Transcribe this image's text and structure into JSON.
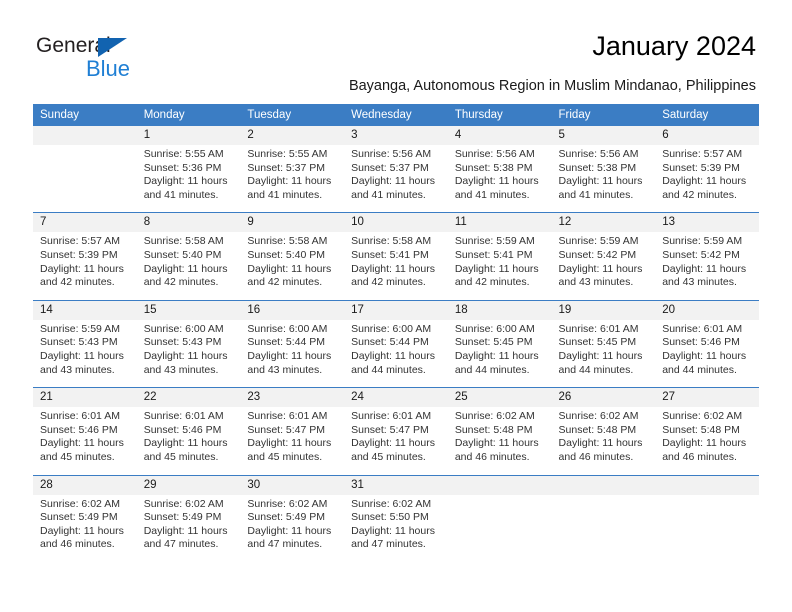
{
  "brand": {
    "name_part1": "General",
    "name_part2": "Blue",
    "triangle_color": "#1263b0",
    "blue_color": "#1f7fd4"
  },
  "header": {
    "title": "January 2024",
    "subtitle": "Bayanga, Autonomous Region in Muslim Mindanao, Philippines"
  },
  "theme": {
    "header_bg": "#3b7dc4",
    "daynum_bg": "#f2f2f2",
    "separator": "#3b7dc4"
  },
  "calendar": {
    "weekday_headers": [
      "Sunday",
      "Monday",
      "Tuesday",
      "Wednesday",
      "Thursday",
      "Friday",
      "Saturday"
    ],
    "weeks": [
      [
        {
          "day": "",
          "sunrise": "",
          "sunset": "",
          "daylight_line1": "",
          "daylight_line2": "",
          "empty": true
        },
        {
          "day": "1",
          "sunrise": "Sunrise: 5:55 AM",
          "sunset": "Sunset: 5:36 PM",
          "daylight_line1": "Daylight: 11 hours",
          "daylight_line2": "and 41 minutes."
        },
        {
          "day": "2",
          "sunrise": "Sunrise: 5:55 AM",
          "sunset": "Sunset: 5:37 PM",
          "daylight_line1": "Daylight: 11 hours",
          "daylight_line2": "and 41 minutes."
        },
        {
          "day": "3",
          "sunrise": "Sunrise: 5:56 AM",
          "sunset": "Sunset: 5:37 PM",
          "daylight_line1": "Daylight: 11 hours",
          "daylight_line2": "and 41 minutes."
        },
        {
          "day": "4",
          "sunrise": "Sunrise: 5:56 AM",
          "sunset": "Sunset: 5:38 PM",
          "daylight_line1": "Daylight: 11 hours",
          "daylight_line2": "and 41 minutes."
        },
        {
          "day": "5",
          "sunrise": "Sunrise: 5:56 AM",
          "sunset": "Sunset: 5:38 PM",
          "daylight_line1": "Daylight: 11 hours",
          "daylight_line2": "and 41 minutes."
        },
        {
          "day": "6",
          "sunrise": "Sunrise: 5:57 AM",
          "sunset": "Sunset: 5:39 PM",
          "daylight_line1": "Daylight: 11 hours",
          "daylight_line2": "and 42 minutes."
        }
      ],
      [
        {
          "day": "7",
          "sunrise": "Sunrise: 5:57 AM",
          "sunset": "Sunset: 5:39 PM",
          "daylight_line1": "Daylight: 11 hours",
          "daylight_line2": "and 42 minutes."
        },
        {
          "day": "8",
          "sunrise": "Sunrise: 5:58 AM",
          "sunset": "Sunset: 5:40 PM",
          "daylight_line1": "Daylight: 11 hours",
          "daylight_line2": "and 42 minutes."
        },
        {
          "day": "9",
          "sunrise": "Sunrise: 5:58 AM",
          "sunset": "Sunset: 5:40 PM",
          "daylight_line1": "Daylight: 11 hours",
          "daylight_line2": "and 42 minutes."
        },
        {
          "day": "10",
          "sunrise": "Sunrise: 5:58 AM",
          "sunset": "Sunset: 5:41 PM",
          "daylight_line1": "Daylight: 11 hours",
          "daylight_line2": "and 42 minutes."
        },
        {
          "day": "11",
          "sunrise": "Sunrise: 5:59 AM",
          "sunset": "Sunset: 5:41 PM",
          "daylight_line1": "Daylight: 11 hours",
          "daylight_line2": "and 42 minutes."
        },
        {
          "day": "12",
          "sunrise": "Sunrise: 5:59 AM",
          "sunset": "Sunset: 5:42 PM",
          "daylight_line1": "Daylight: 11 hours",
          "daylight_line2": "and 43 minutes."
        },
        {
          "day": "13",
          "sunrise": "Sunrise: 5:59 AM",
          "sunset": "Sunset: 5:42 PM",
          "daylight_line1": "Daylight: 11 hours",
          "daylight_line2": "and 43 minutes."
        }
      ],
      [
        {
          "day": "14",
          "sunrise": "Sunrise: 5:59 AM",
          "sunset": "Sunset: 5:43 PM",
          "daylight_line1": "Daylight: 11 hours",
          "daylight_line2": "and 43 minutes."
        },
        {
          "day": "15",
          "sunrise": "Sunrise: 6:00 AM",
          "sunset": "Sunset: 5:43 PM",
          "daylight_line1": "Daylight: 11 hours",
          "daylight_line2": "and 43 minutes."
        },
        {
          "day": "16",
          "sunrise": "Sunrise: 6:00 AM",
          "sunset": "Sunset: 5:44 PM",
          "daylight_line1": "Daylight: 11 hours",
          "daylight_line2": "and 43 minutes."
        },
        {
          "day": "17",
          "sunrise": "Sunrise: 6:00 AM",
          "sunset": "Sunset: 5:44 PM",
          "daylight_line1": "Daylight: 11 hours",
          "daylight_line2": "and 44 minutes."
        },
        {
          "day": "18",
          "sunrise": "Sunrise: 6:00 AM",
          "sunset": "Sunset: 5:45 PM",
          "daylight_line1": "Daylight: 11 hours",
          "daylight_line2": "and 44 minutes."
        },
        {
          "day": "19",
          "sunrise": "Sunrise: 6:01 AM",
          "sunset": "Sunset: 5:45 PM",
          "daylight_line1": "Daylight: 11 hours",
          "daylight_line2": "and 44 minutes."
        },
        {
          "day": "20",
          "sunrise": "Sunrise: 6:01 AM",
          "sunset": "Sunset: 5:46 PM",
          "daylight_line1": "Daylight: 11 hours",
          "daylight_line2": "and 44 minutes."
        }
      ],
      [
        {
          "day": "21",
          "sunrise": "Sunrise: 6:01 AM",
          "sunset": "Sunset: 5:46 PM",
          "daylight_line1": "Daylight: 11 hours",
          "daylight_line2": "and 45 minutes."
        },
        {
          "day": "22",
          "sunrise": "Sunrise: 6:01 AM",
          "sunset": "Sunset: 5:46 PM",
          "daylight_line1": "Daylight: 11 hours",
          "daylight_line2": "and 45 minutes."
        },
        {
          "day": "23",
          "sunrise": "Sunrise: 6:01 AM",
          "sunset": "Sunset: 5:47 PM",
          "daylight_line1": "Daylight: 11 hours",
          "daylight_line2": "and 45 minutes."
        },
        {
          "day": "24",
          "sunrise": "Sunrise: 6:01 AM",
          "sunset": "Sunset: 5:47 PM",
          "daylight_line1": "Daylight: 11 hours",
          "daylight_line2": "and 45 minutes."
        },
        {
          "day": "25",
          "sunrise": "Sunrise: 6:02 AM",
          "sunset": "Sunset: 5:48 PM",
          "daylight_line1": "Daylight: 11 hours",
          "daylight_line2": "and 46 minutes."
        },
        {
          "day": "26",
          "sunrise": "Sunrise: 6:02 AM",
          "sunset": "Sunset: 5:48 PM",
          "daylight_line1": "Daylight: 11 hours",
          "daylight_line2": "and 46 minutes."
        },
        {
          "day": "27",
          "sunrise": "Sunrise: 6:02 AM",
          "sunset": "Sunset: 5:48 PM",
          "daylight_line1": "Daylight: 11 hours",
          "daylight_line2": "and 46 minutes."
        }
      ],
      [
        {
          "day": "28",
          "sunrise": "Sunrise: 6:02 AM",
          "sunset": "Sunset: 5:49 PM",
          "daylight_line1": "Daylight: 11 hours",
          "daylight_line2": "and 46 minutes."
        },
        {
          "day": "29",
          "sunrise": "Sunrise: 6:02 AM",
          "sunset": "Sunset: 5:49 PM",
          "daylight_line1": "Daylight: 11 hours",
          "daylight_line2": "and 47 minutes."
        },
        {
          "day": "30",
          "sunrise": "Sunrise: 6:02 AM",
          "sunset": "Sunset: 5:49 PM",
          "daylight_line1": "Daylight: 11 hours",
          "daylight_line2": "and 47 minutes."
        },
        {
          "day": "31",
          "sunrise": "Sunrise: 6:02 AM",
          "sunset": "Sunset: 5:50 PM",
          "daylight_line1": "Daylight: 11 hours",
          "daylight_line2": "and 47 minutes."
        },
        {
          "day": "",
          "sunrise": "",
          "sunset": "",
          "daylight_line1": "",
          "daylight_line2": "",
          "empty": true
        },
        {
          "day": "",
          "sunrise": "",
          "sunset": "",
          "daylight_line1": "",
          "daylight_line2": "",
          "empty": true
        },
        {
          "day": "",
          "sunrise": "",
          "sunset": "",
          "daylight_line1": "",
          "daylight_line2": "",
          "empty": true
        }
      ]
    ]
  }
}
